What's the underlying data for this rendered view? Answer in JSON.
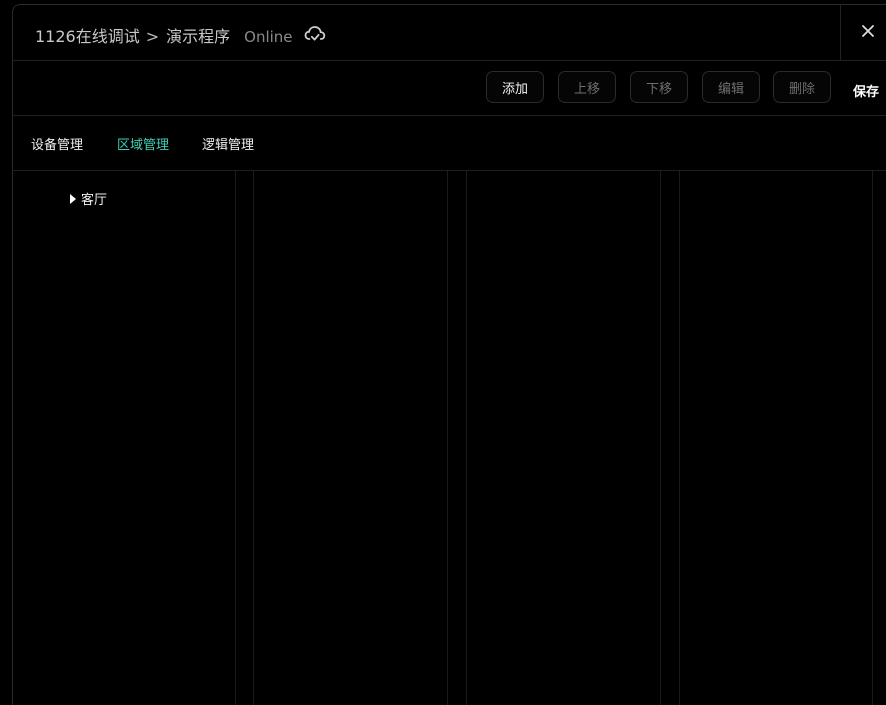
{
  "header": {
    "project": "1126在线调试",
    "separator": ">",
    "program": "演示程序",
    "status": "Online"
  },
  "toolbar": {
    "add_label": "添加",
    "move_up_label": "上移",
    "move_down_label": "下移",
    "edit_label": "编辑",
    "delete_label": "删除",
    "save_label": "保存"
  },
  "tabs": [
    {
      "label": "设备管理"
    },
    {
      "label": "区域管理"
    },
    {
      "label": "逻辑管理"
    }
  ],
  "tree": {
    "items": [
      {
        "label": "客厅"
      }
    ]
  },
  "colors": {
    "accent": "#3ecfb4",
    "background": "#000000"
  },
  "icons": {
    "cloud": "cloud-check-icon",
    "close": "close-icon",
    "caret": "caret-right-icon"
  }
}
